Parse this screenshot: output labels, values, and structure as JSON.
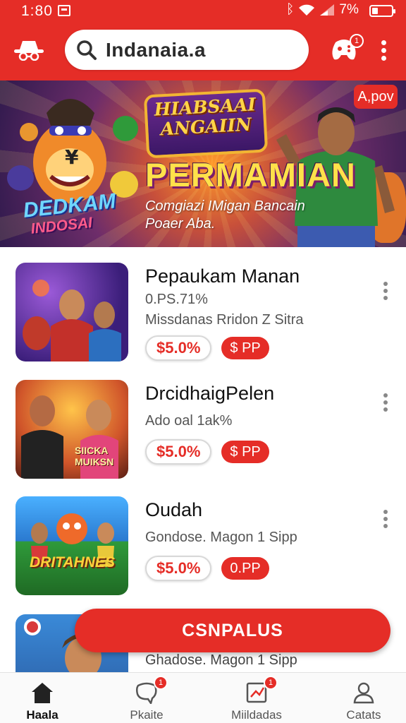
{
  "status_bar": {
    "time": "1:80",
    "battery_text": "7%"
  },
  "header": {
    "search_text": "Indanaia.a",
    "badge_count": "1",
    "colors": {
      "brand": "#e52d27"
    }
  },
  "banner": {
    "sign_text": "HIABSAAI ANGAIIN",
    "title": "PERMAMIAN",
    "subtitle": "Comgiazi IMigan Bancain Poaer Aba.",
    "logo_line1": "DEDKAM",
    "logo_line2": "INDOSAI",
    "badge": "A,pov"
  },
  "games": [
    {
      "title": "Pepaukam Manan",
      "line1": "0.PS.71%",
      "line2": "Missdanas Rridon Z Sitra",
      "price": "$5.0%",
      "tag": "$ PP"
    },
    {
      "title": "DrcidhaigPelen",
      "line1": "Ado oal 1ak%",
      "line2": "",
      "price": "$5.0%",
      "tag": "$ PP",
      "thumb_text": "SIICKA MUIKSN"
    },
    {
      "title": "Oudah",
      "line1": "Gondose. Magon 1 Sipp",
      "line2": "",
      "price": "$5.0%",
      "tag": "0.PP",
      "thumb_text": "DRITAHNES"
    },
    {
      "title": "",
      "line1": "Ghadose. Magon 1 Sipp",
      "line2": ""
    }
  ],
  "fab_label": "CSNPALUS",
  "bottom_nav": [
    {
      "label": "Haala",
      "icon": "home-icon",
      "active": true
    },
    {
      "label": "Pkaite",
      "icon": "chat-icon",
      "badge": "1"
    },
    {
      "label": "Miildadas",
      "icon": "tasks-icon",
      "badge": "1"
    },
    {
      "label": "Catats",
      "icon": "profile-icon"
    }
  ]
}
